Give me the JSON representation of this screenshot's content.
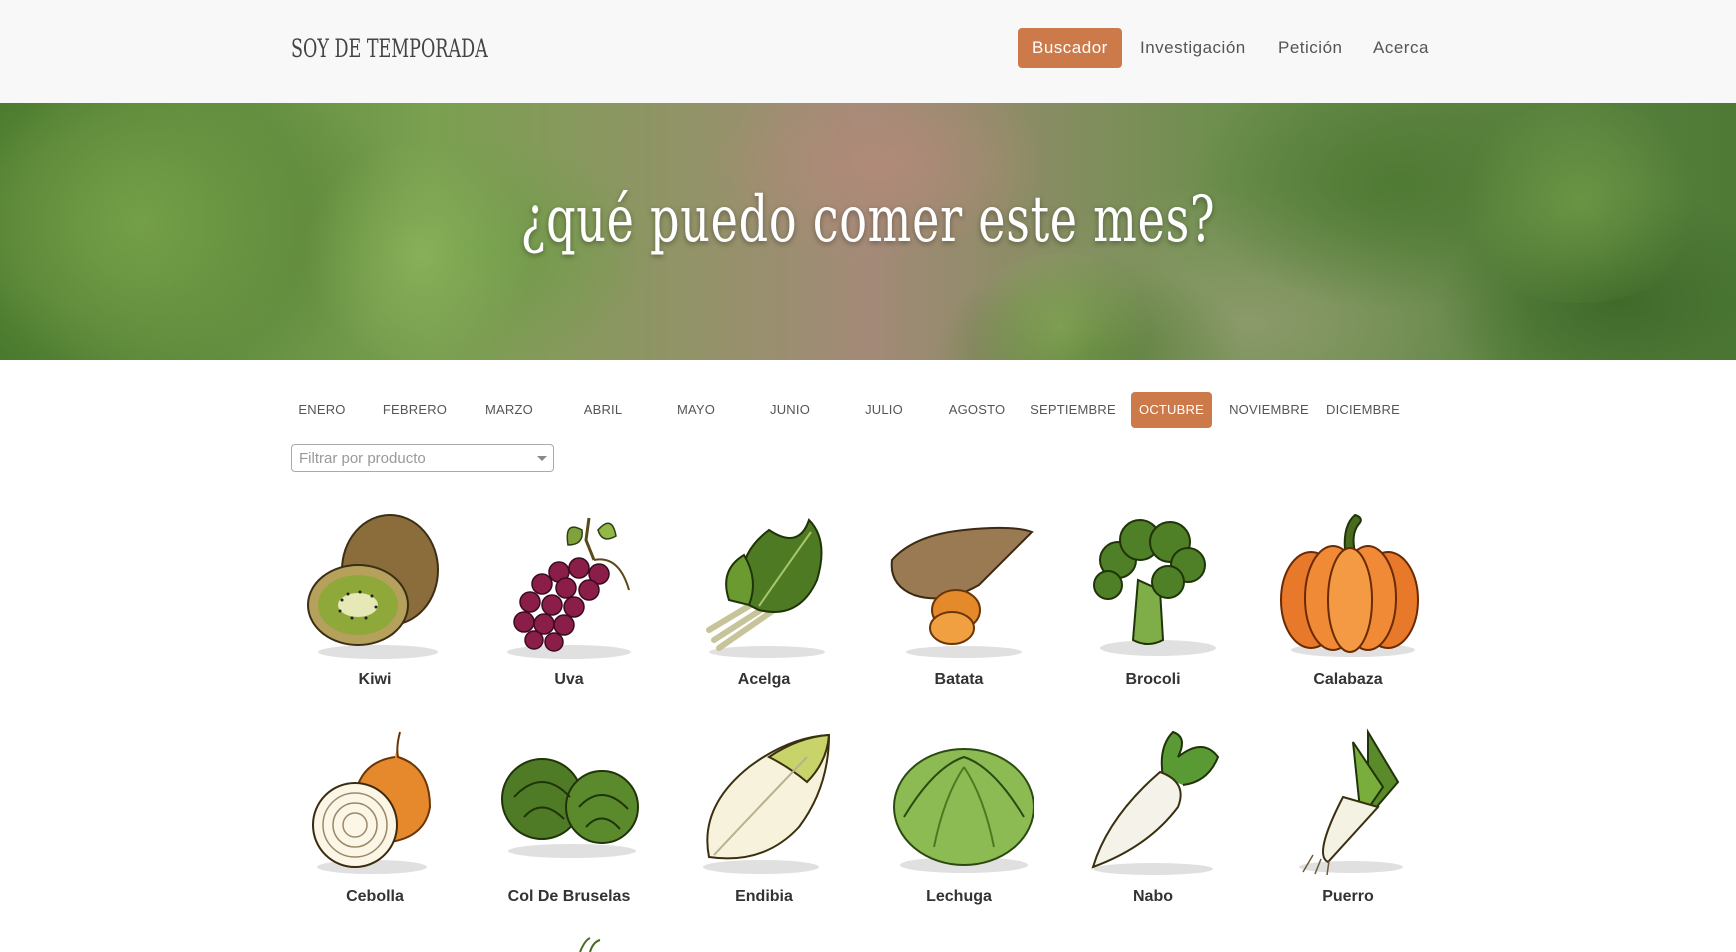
{
  "header": {
    "brand": "SOY DE TEMPORADA",
    "nav": [
      {
        "label": "Buscador",
        "active": true
      },
      {
        "label": "Investigación",
        "active": false
      },
      {
        "label": "Petición",
        "active": false
      },
      {
        "label": "Acerca",
        "active": false
      }
    ]
  },
  "hero": {
    "title": "¿qué puedo comer este mes?"
  },
  "months": [
    {
      "label": "ENERO",
      "active": false
    },
    {
      "label": "FEBRERO",
      "active": false
    },
    {
      "label": "MARZO",
      "active": false
    },
    {
      "label": "ABRIL",
      "active": false
    },
    {
      "label": "MAYO",
      "active": false
    },
    {
      "label": "JUNIO",
      "active": false
    },
    {
      "label": "JULIO",
      "active": false
    },
    {
      "label": "AGOSTO",
      "active": false
    },
    {
      "label": "SEPTIEMBRE",
      "active": false
    },
    {
      "label": "OCTUBRE",
      "active": true
    },
    {
      "label": "NOVIEMBRE",
      "active": false
    },
    {
      "label": "DICIEMBRE",
      "active": false
    }
  ],
  "filter": {
    "placeholder": "Filtrar por producto"
  },
  "products": [
    {
      "name": "Kiwi",
      "icon": "kiwi-icon"
    },
    {
      "name": "Uva",
      "icon": "grape-icon"
    },
    {
      "name": "Acelga",
      "icon": "chard-icon"
    },
    {
      "name": "Batata",
      "icon": "sweet-potato-icon"
    },
    {
      "name": "Brocoli",
      "icon": "broccoli-icon"
    },
    {
      "name": "Calabaza",
      "icon": "pumpkin-icon"
    },
    {
      "name": "Cebolla",
      "icon": "onion-icon"
    },
    {
      "name": "Col De Bruselas",
      "icon": "brussels-sprouts-icon"
    },
    {
      "name": "Endibia",
      "icon": "endive-icon"
    },
    {
      "name": "Lechuga",
      "icon": "lettuce-icon"
    },
    {
      "name": "Nabo",
      "icon": "turnip-icon"
    },
    {
      "name": "Puerro",
      "icon": "leek-icon"
    }
  ],
  "colors": {
    "accent": "#cc7a4a",
    "header_bg": "#f8f8f8"
  }
}
